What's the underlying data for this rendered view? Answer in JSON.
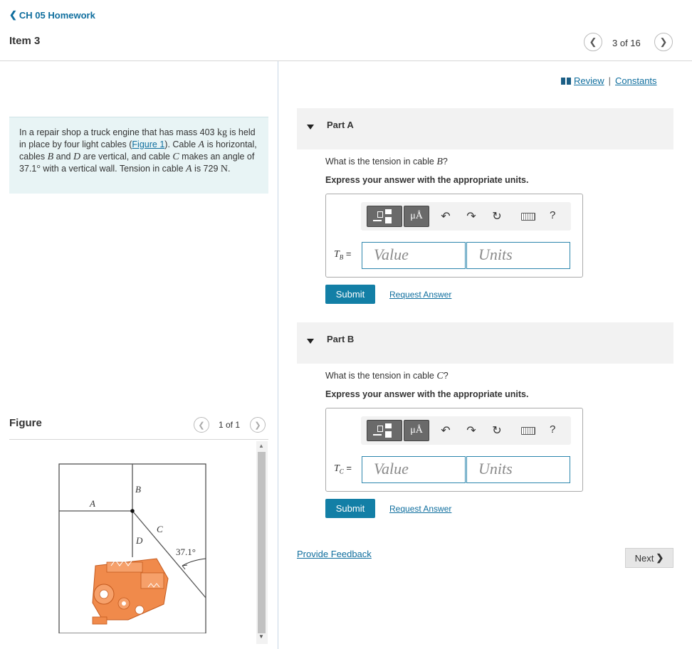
{
  "nav": {
    "back_label": "CH 05 Homework",
    "item_title": "Item 3",
    "item_count": "3 of 16"
  },
  "links": {
    "review": "Review",
    "separator": "|",
    "constants": "Constants"
  },
  "problem": {
    "t1": "In a repair shop a truck engine that has mass 403 ",
    "u_kg": "kg",
    "t2": " is held in place by four light cables (",
    "figure_link": "Figure 1",
    "t3": "). Cable ",
    "A": "A",
    "t4": " is horizontal, cables ",
    "B": "B",
    "t5": " and ",
    "D": "D",
    "t6": " are vertical, and cable ",
    "C": "C",
    "t7": " makes an angle of 37.1",
    "deg": "°",
    "t8": " with a vertical wall. Tension in cable ",
    "A2": "A",
    "t9": " is 729 ",
    "u_N": "N",
    "t10": "."
  },
  "figure": {
    "label": "Figure",
    "count": "1 of 1",
    "labels": {
      "A": "A",
      "B": "B",
      "C": "C",
      "D": "D",
      "angle": "37.1°"
    }
  },
  "toolbar": {
    "units_symbol": "μÅ",
    "help": "?"
  },
  "parts": [
    {
      "title": "Part A",
      "q1": "What is the tension in cable ",
      "qvar": "B",
      "q2": "?",
      "instruction": "Express your answer with the appropriate units.",
      "var": "T",
      "sub": "B",
      "eq": " =",
      "value_placeholder": "Value",
      "units_placeholder": "Units",
      "submit": "Submit",
      "request": "Request Answer"
    },
    {
      "title": "Part B",
      "q1": "What is the tension in cable ",
      "qvar": "C",
      "q2": "?",
      "instruction": "Express your answer with the appropriate units.",
      "var": "T",
      "sub": "C",
      "eq": " =",
      "value_placeholder": "Value",
      "units_placeholder": "Units",
      "submit": "Submit",
      "request": "Request Answer"
    }
  ],
  "footer": {
    "feedback": "Provide Feedback",
    "next": "Next"
  }
}
